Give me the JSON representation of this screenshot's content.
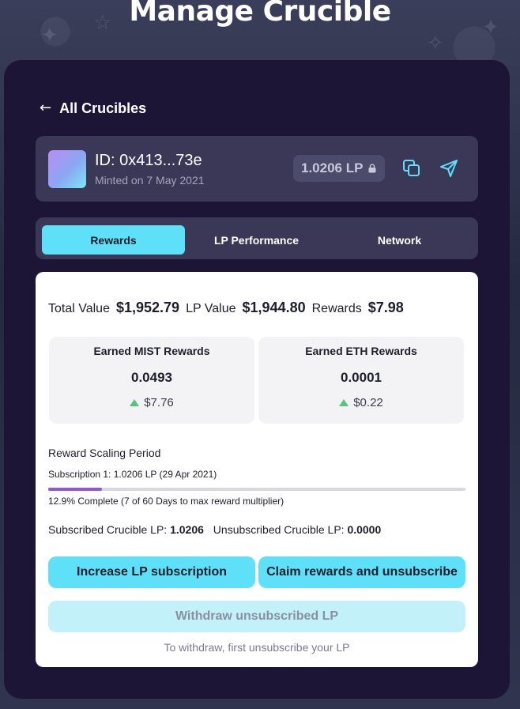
{
  "page": {
    "title": "Manage Crucible"
  },
  "nav": {
    "back_label": "All Crucibles"
  },
  "crucible": {
    "id": "ID: 0x413...73e",
    "minted": "Minted on 7 May 2021",
    "lp_amount": "1.0206 LP",
    "lock_icon": "lock-icon",
    "copy_icon": "copy-icon",
    "send_icon": "send-icon"
  },
  "tabs": [
    {
      "label": "Rewards",
      "active": true
    },
    {
      "label": "LP Performance",
      "active": false
    },
    {
      "label": "Network",
      "active": false
    }
  ],
  "totals": {
    "total_label": "Total Value",
    "total_value": "$1,952.79",
    "lp_label": "LP Value",
    "lp_value": "$1,944.80",
    "rewards_label": "Rewards",
    "rewards_value": "$7.98"
  },
  "rewards": [
    {
      "title": "Earned MIST Rewards",
      "amount": "0.0493",
      "usd": "$7.76"
    },
    {
      "title": "Earned ETH Rewards",
      "amount": "0.0001",
      "usd": "$0.22"
    }
  ],
  "scaling": {
    "title": "Reward Scaling Period",
    "subscription": "Subscription 1: 1.0206 LP (29 Apr 2021)",
    "progress_percent": 12.9,
    "progress_label": "12.9% Complete (7 of 60 Days to max reward multiplier)"
  },
  "subscription_status": {
    "subscribed_label": "Subscribed Crucible LP:",
    "subscribed_value": "1.0206",
    "unsubscribed_label": "Unsubscribed Crucible LP:",
    "unsubscribed_value": "0.0000"
  },
  "actions": {
    "increase_label": "Increase LP subscription",
    "claim_label": "Claim rewards and unsubscribe",
    "withdraw_label": "Withdraw unsubscribed LP",
    "withdraw_note": "To withdraw, first unsubscribe your LP"
  },
  "colors": {
    "accent": "#5ee0f8",
    "panel": "#1d1536",
    "card": "#3a3856",
    "progress": "#8e54e9",
    "positive": "#59c27e"
  }
}
